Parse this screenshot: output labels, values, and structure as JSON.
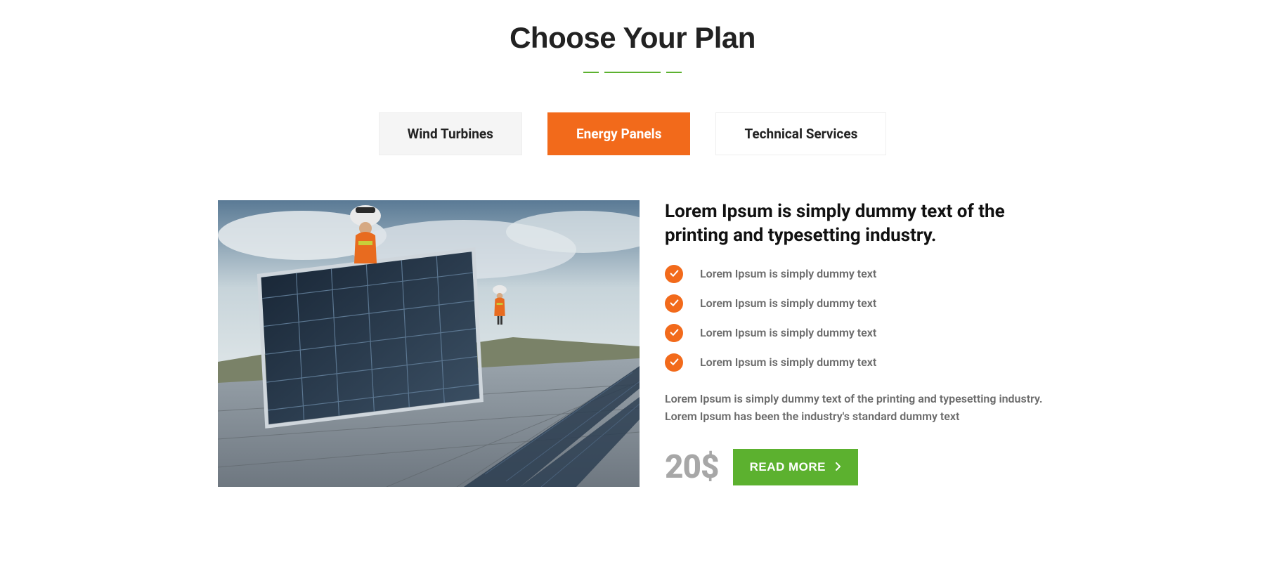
{
  "heading": "Choose Your Plan",
  "tabs": [
    {
      "label": "Wind Turbines",
      "active": false,
      "style": "default"
    },
    {
      "label": "Energy Panels",
      "active": true,
      "style": "active"
    },
    {
      "label": "Technical Services",
      "active": false,
      "style": "outline"
    }
  ],
  "headline": "Lorem Ipsum is simply dummy text of the printing and typesetting industry.",
  "features": [
    "Lorem Ipsum is simply dummy text",
    "Lorem Ipsum is simply dummy text",
    "Lorem Ipsum is simply dummy text",
    "Lorem Ipsum is simply dummy text"
  ],
  "description": "Lorem Ipsum is simply dummy text of the printing and typesetting industry. Lorem Ipsum has been the industry's standard dummy text",
  "price": "20$",
  "cta": "READ MORE",
  "colors": {
    "accent_orange": "#f26a1b",
    "accent_green": "#5cb12f",
    "muted": "#6b6b6b",
    "price_gray": "#a7a7a7"
  }
}
